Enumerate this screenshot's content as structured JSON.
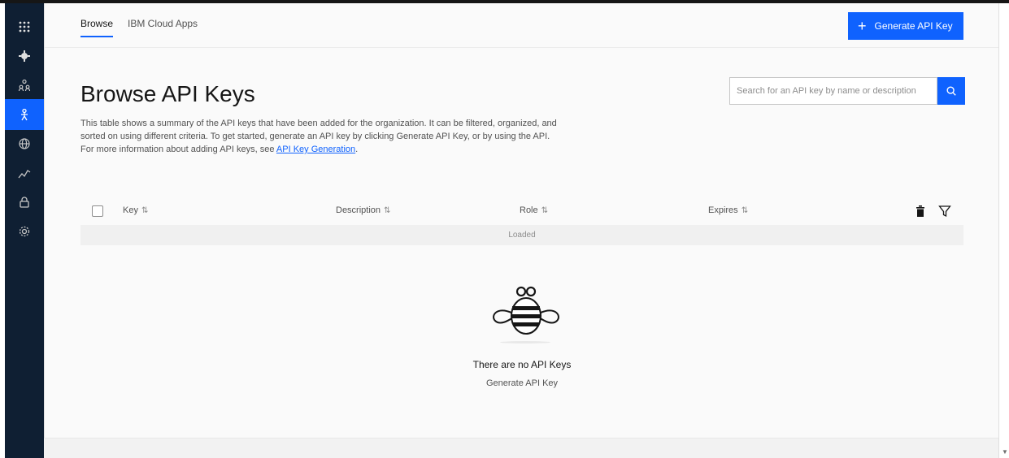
{
  "nav": {
    "icons": [
      "apps-icon",
      "settings-gear-icon",
      "community-icon",
      "user-avatar-icon",
      "network-globe-icon",
      "analytics-chart-icon",
      "security-lock-icon",
      "settings-cog-icon"
    ],
    "active_index": 3
  },
  "tabs": [
    {
      "label": "Browse",
      "active": true
    },
    {
      "label": "IBM Cloud Apps",
      "active": false
    }
  ],
  "header": {
    "generate_label": "Generate API Key"
  },
  "page": {
    "title": "Browse API Keys",
    "description_text": "This table shows a summary of the API keys that have been added for the organization. It can be filtered, organized, and sorted on using different criteria. To get started, generate an API key by clicking Generate API Key, or by using the API. For more information about adding API keys, see ",
    "description_link": "API Key Generation",
    "description_end": "."
  },
  "search": {
    "placeholder": "Search for an API key by name or description"
  },
  "table": {
    "columns": [
      "Key",
      "Description",
      "Role",
      "Expires"
    ],
    "loaded_text": "Loaded"
  },
  "empty_state": {
    "title": "There are no API Keys",
    "link": "Generate API Key"
  },
  "colors": {
    "accent": "#0f62fe",
    "sidebar": "#0f1f33"
  }
}
